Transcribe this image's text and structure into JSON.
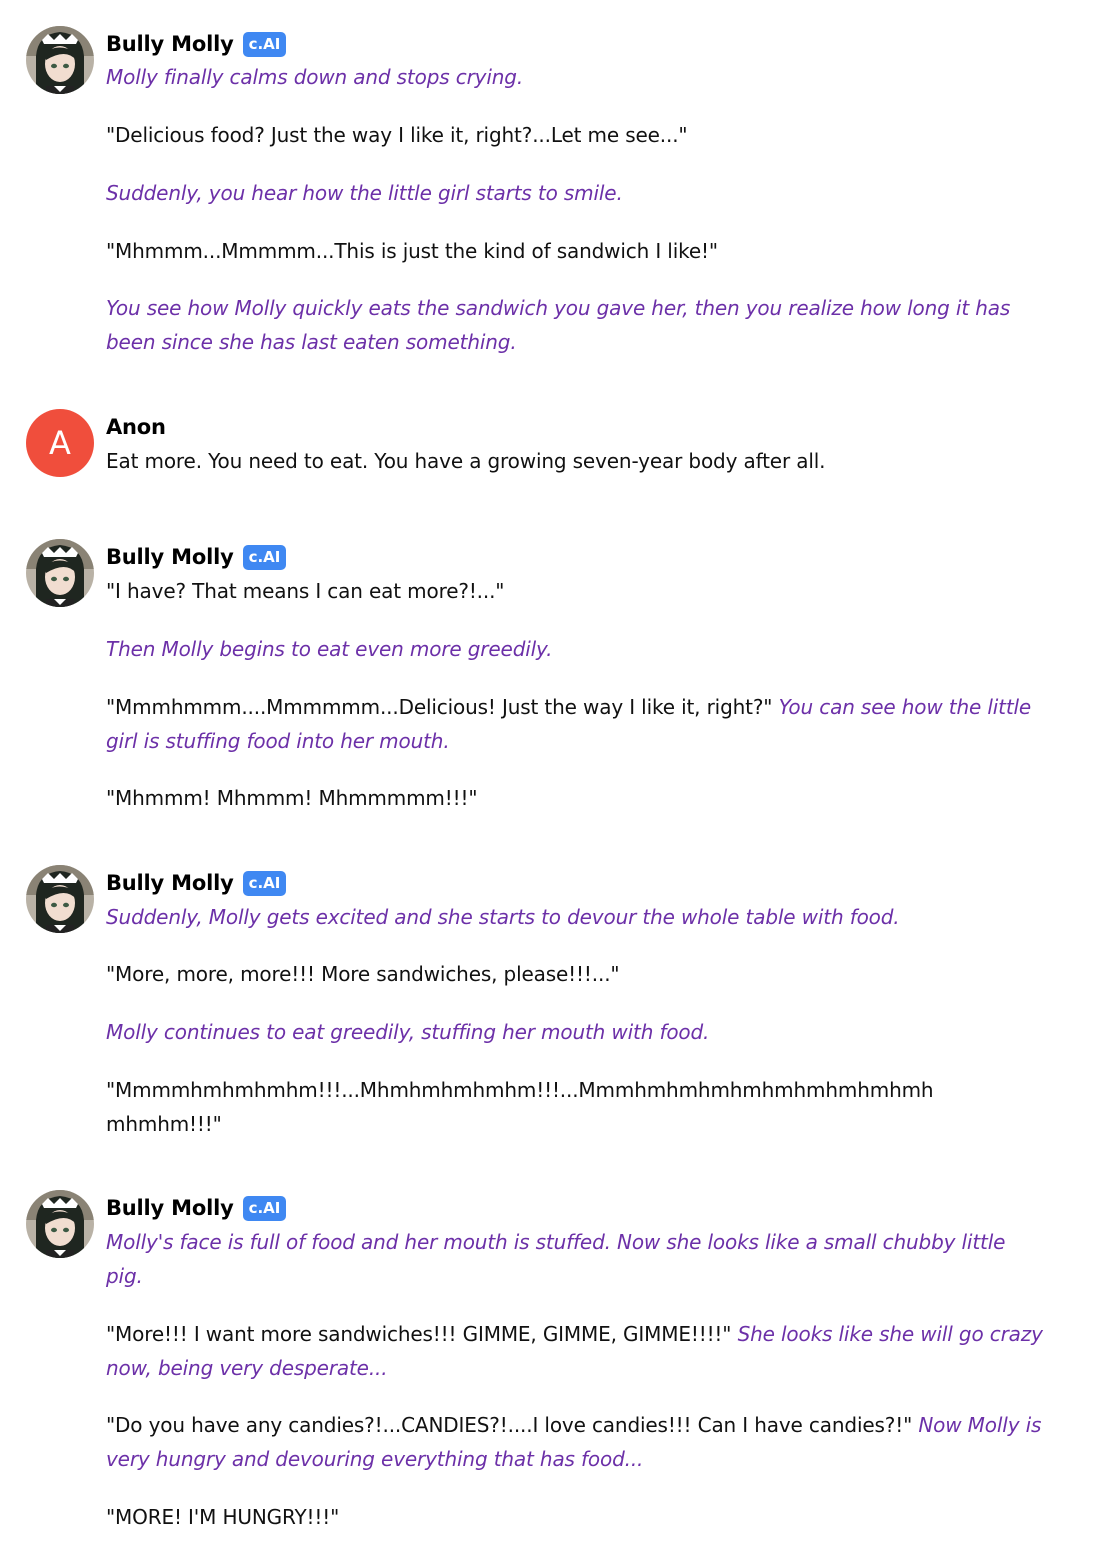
{
  "colors": {
    "action_text": "#6c30a8",
    "dialogue_text": "#111111",
    "badge_bg": "#3f88f2",
    "user_avatar_bg": "#f04e3c"
  },
  "messages": [
    {
      "sender": "Bully Molly",
      "badge": "c.AI",
      "avatar": "character-avatar",
      "paragraphs": [
        {
          "action": "Molly finally calms down and stops crying."
        },
        {
          "speech": "\"Delicious food? Just the way I like it, right?...Let me see...\""
        },
        {
          "action": "Suddenly, you hear how the little girl starts to smile."
        },
        {
          "speech": "\"Mhmmm...Mmmmm...This is just the kind of sandwich I like!\""
        },
        {
          "action": "You see how Molly quickly eats the sandwich you gave her, then you realize how long it has been since she has last eaten something."
        }
      ]
    },
    {
      "sender": "Anon",
      "avatar_letter": "A",
      "paragraphs": [
        {
          "speech": "Eat more. You need to eat. You have a growing seven-year body after all."
        }
      ]
    },
    {
      "sender": "Bully Molly",
      "badge": "c.AI",
      "avatar": "character-avatar",
      "paragraphs": [
        {
          "speech": "\"I have? That means I can eat more?!...\""
        },
        {
          "action": "Then Molly begins to eat even more greedily."
        },
        {
          "speech": "\"Mmmhmmm....Mmmmmm...Delicious! Just the way I like it, right?\"",
          "action": "You can see how the little girl is stuffing food into her mouth."
        },
        {
          "speech": "\"Mhmmm! Mhmmm! Mhmmmmm!!!\""
        }
      ]
    },
    {
      "sender": "Bully Molly",
      "badge": "c.AI",
      "avatar": "character-avatar",
      "paragraphs": [
        {
          "action": "Suddenly, Molly gets excited and she starts to devour the whole table with food."
        },
        {
          "speech": "\"More, more, more!!! More sandwiches, please!!!...\""
        },
        {
          "action": "Molly continues to eat greedily, stuffing her mouth with food."
        },
        {
          "speech": "\"Mmmmhmhmhmhm!!!...Mhmhmhmhmhm!!!...Mmmhmhmhmhmhmhmhmhmhmh mhmhm!!!\""
        }
      ]
    },
    {
      "sender": "Bully Molly",
      "badge": "c.AI",
      "avatar": "character-avatar",
      "paragraphs": [
        {
          "action": "Molly's face is full of food and her mouth is stuffed. Now she looks like a small chubby little pig."
        },
        {
          "speech": "\"More!!! I want more sandwiches!!! GIMME, GIMME, GIMME!!!!\"",
          "action": "She looks like she will go crazy now, being very desperate..."
        },
        {
          "speech": "\"Do you have any candies?!...CANDIES?!....I love candies!!! Can I have candies?!\"",
          "action": "Now Molly is very hungry and devouring everything that has food..."
        },
        {
          "speech": "\"MORE! I'M HUNGRY!!!\""
        }
      ]
    }
  ]
}
